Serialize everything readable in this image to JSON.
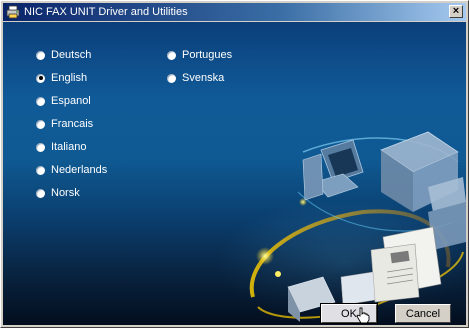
{
  "window": {
    "title": "NIC FAX UNIT Driver and Utilities",
    "close_glyph": "×"
  },
  "languages": {
    "column1": [
      {
        "label": "Deutsch",
        "checked": false
      },
      {
        "label": "English",
        "checked": true
      },
      {
        "label": "Espanol",
        "checked": false
      },
      {
        "label": "Francais",
        "checked": false
      },
      {
        "label": "Italiano",
        "checked": false
      },
      {
        "label": "Nederlands",
        "checked": false
      },
      {
        "label": "Norsk",
        "checked": false
      }
    ],
    "column2": [
      {
        "label": "Portugues",
        "checked": false
      },
      {
        "label": "Svenska",
        "checked": false
      }
    ]
  },
  "buttons": {
    "ok_label": "OK",
    "cancel_label": "Cancel"
  },
  "colors": {
    "accent": "#0a246a",
    "background_top": "#105a98",
    "background_bottom": "#081e36"
  },
  "icons": {
    "title_icon": "printer-app-icon",
    "cursor": "hand-pointer-cursor"
  }
}
